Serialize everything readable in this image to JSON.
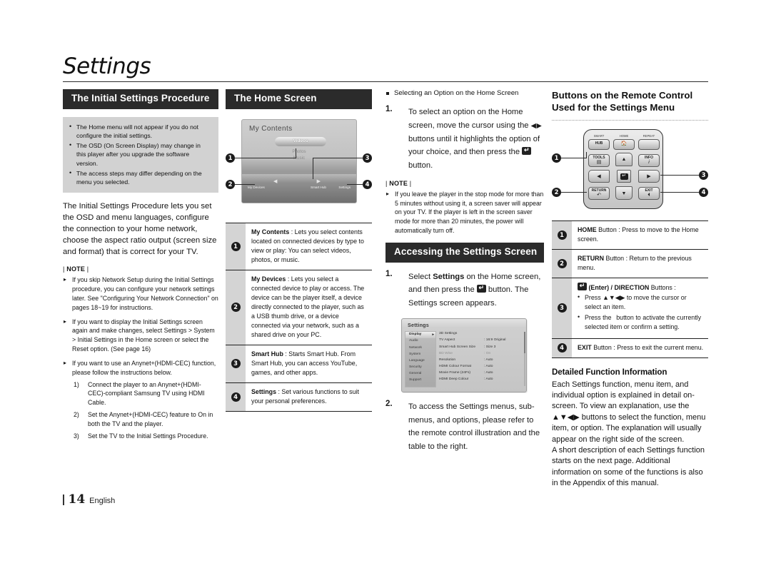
{
  "chapter": {
    "title": "Settings"
  },
  "footer": {
    "page": "14",
    "language": "English"
  },
  "col1": {
    "header": "The Initial Settings Procedure",
    "tips": [
      "The Home menu will not appear if you do not configure the initial settings.",
      "The OSD (On Screen Display) may change in this player after you upgrade the software version.",
      "The access steps may differ depending on the menu you selected."
    ],
    "intro": "The Initial Settings Procedure lets you set the OSD and menu languages, configure the connection to your home network, choose the aspect ratio output (screen size and format) that is correct for your TV.",
    "note_label": "NOTE",
    "notes": [
      "If you skip Network Setup during the Initial Settings procedure, you can configure your network settings later. See \"Configuring Your Network Connection\" on pages 18~19 for instructions.",
      "If you want to display the Initial Settings screen again and make changes, select Settings > System > Initial Settings in the Home screen or select the Reset option. (See page 16)",
      "If you want to use an Anynet+(HDMI-CEC) function, please follow the instructions below."
    ],
    "substeps": [
      {
        "num": "1)",
        "text": "Connect the player to an Anynet+(HDMI-CEC)-compliant Samsung TV using HDMI Cable."
      },
      {
        "num": "2)",
        "text": "Set the Anynet+(HDMI-CEC) feature to On in both the TV and the player."
      },
      {
        "num": "3)",
        "text": "Set the TV to the Initial Settings Procedure."
      }
    ]
  },
  "col2": {
    "header": "The Home Screen",
    "home_screen": {
      "title": "My Contents",
      "selected_item": "Videos",
      "other_items": [
        "Photos",
        "Music"
      ],
      "icons": [
        {
          "label": "My Devices"
        },
        {
          "label": "Smart Hub"
        },
        {
          "label": "Settings"
        }
      ],
      "badges": [
        "1",
        "2",
        "3",
        "4"
      ]
    },
    "callouts": [
      {
        "num": "1",
        "term": "My Contents",
        "text": " : Lets you select contents located on connected devices by type to view or play: You can select videos, photos, or music."
      },
      {
        "num": "2",
        "term": "My Devices",
        "text": " : Lets you select a connected device to play or access. The device can be the player itself, a device directly connected to the player, such as a USB thumb drive, or a device connected via your network, such as a shared drive on your PC."
      },
      {
        "num": "3",
        "term": "Smart Hub",
        "text": " : Starts Smart Hub. From Smart Hub, you can access YouTube, games, and other apps."
      },
      {
        "num": "4",
        "term": "Settings",
        "text": " : Set various functions to suit your personal preferences."
      }
    ]
  },
  "col3": {
    "sq_heading": "Selecting an Option on the Home Screen",
    "step1_num": "1.",
    "step1_a": "To select an option on the Home screen, move the cursor using the ",
    "step1_arrows": "◀▶",
    "step1_b": " buttons until it highlights the option of your choice, and then press the ",
    "step1_c": " button.",
    "note_label": "NOTE",
    "note": "If you leave the player in the stop mode for more than 5 minutes without using it, a screen saver will appear on your TV. If the player is left in the screen saver mode for more than 20 minutes, the power will automatically turn off.",
    "header2": "Accessing the Settings Screen",
    "step_a_num": "1.",
    "step_a_1": "Select ",
    "step_a_bold": "Settings",
    "step_a_2": " on the Home screen, and then press the ",
    "step_a_3": " button. The Settings screen appears.",
    "settings_screen": {
      "title": "Settings",
      "sidebar": [
        "Display",
        "Audio",
        "Network",
        "System",
        "Language",
        "Security",
        "General",
        "Support"
      ],
      "selected_sidebar": "Display",
      "rows": [
        {
          "name": "3D Settings",
          "value": ""
        },
        {
          "name": "TV Aspect",
          "value": ": 16:9 Original"
        },
        {
          "name": "Smart Hub Screen Size",
          "value": ": Size 3"
        },
        {
          "name": "BD Wise",
          "value": ": On",
          "dim": true
        },
        {
          "name": "Resolution",
          "value": ": Auto"
        },
        {
          "name": "HDMI Colour Format",
          "value": ": Auto"
        },
        {
          "name": "Movie Frame (24Fs)",
          "value": ": Auto"
        },
        {
          "name": "HDMI Deep Colour",
          "value": ": Auto"
        }
      ]
    },
    "step_b_num": "2.",
    "step_b": "To access the Settings menus, sub-menus, and options, please refer to the remote control illustration and the table to the right."
  },
  "col4": {
    "header_line1": "Buttons on the Remote Control",
    "header_line2": "Used for the Settings Menu",
    "remote": {
      "captions": [
        "SMART",
        "HOME",
        "REPEAT"
      ],
      "keys": [
        {
          "label": "HUB"
        },
        {
          "label": "TOOLS"
        },
        {
          "label": "INFO"
        },
        {
          "label": "RETURN"
        },
        {
          "label": "EXIT"
        }
      ],
      "badges": [
        "1",
        "2",
        "3",
        "4"
      ]
    },
    "callouts": [
      {
        "num": "1",
        "term": "HOME",
        "text": " Button : Press to move to the Home screen."
      },
      {
        "num": "2",
        "term": "RETURN",
        "text": " Button : Return to the previous menu."
      },
      {
        "num": "3",
        "term": "(Enter) / DIRECTION",
        "text": " Buttons :",
        "bullets": [
          "Press ▲▼◀▶ to move the cursor or select an item.",
          "Press the   button to activate the currently selected item or confirm a setting."
        ]
      },
      {
        "num": "4",
        "term": "EXIT",
        "text": " Button : Press to exit the current menu."
      }
    ],
    "detail_head": "Detailed Function Information",
    "detail_body": "Each Settings function, menu item, and individual option is explained in detail on-screen. To view an explanation, use the ▲▼◀▶ buttons to select the function, menu item, or option. The explanation will usually appear on the right side of the screen.\nA short description of each Settings function starts on the next page. Additional information on some of the functions is also in the Appendix of this manual."
  }
}
